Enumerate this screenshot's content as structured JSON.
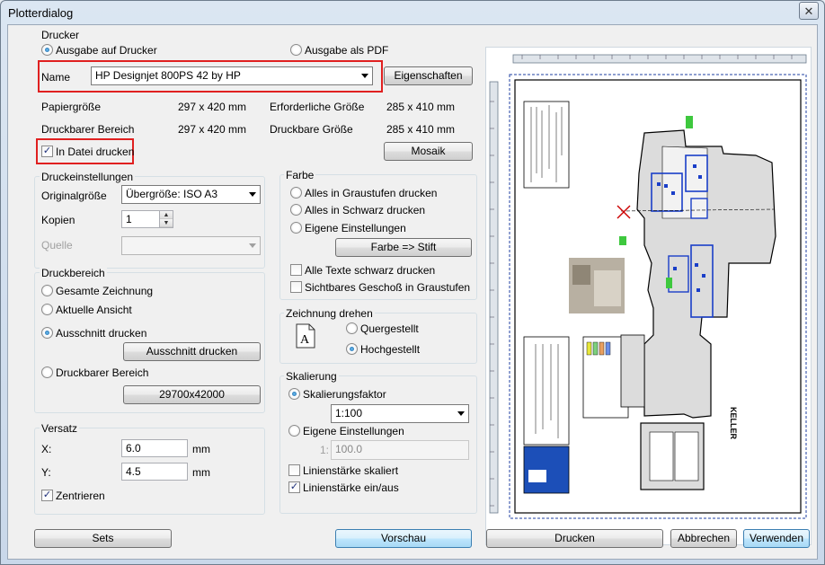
{
  "window": {
    "title": "Plotterdialog",
    "close_glyph": "✕"
  },
  "drucker": {
    "group_label": "Drucker",
    "radio_printer": "Ausgabe auf Drucker",
    "radio_pdf": "Ausgabe als PDF",
    "name_label": "Name",
    "printer_name": "HP Designjet 800PS 42 by HP",
    "properties_button": "Eigenschaften",
    "paper_size_label": "Papiergröße",
    "paper_size_value": "297 x 420 mm",
    "required_size_label": "Erforderliche Größe",
    "required_size_value": "285 x 410 mm",
    "printable_area_label": "Druckbarer Bereich",
    "printable_area_value": "297 x 420 mm",
    "printable_size_label": "Druckbare Größe",
    "printable_size_value": "285 x 410 mm",
    "print_to_file_label": "In Datei drucken",
    "print_to_file_checked": true,
    "mosaic_button": "Mosaik"
  },
  "druckeinstellungen": {
    "group_label": "Druckeinstellungen",
    "original_size_label": "Originalgröße",
    "original_size_value": "Übergröße: ISO A3",
    "copies_label": "Kopien",
    "copies_value": "1",
    "source_label": "Quelle",
    "source_value": ""
  },
  "druckbereich": {
    "group_label": "Druckbereich",
    "radio_full": "Gesamte Zeichnung",
    "radio_current": "Aktuelle Ansicht",
    "radio_section": "Ausschnitt drucken",
    "section_button": "Ausschnitt drucken",
    "radio_printable": "Druckbarer Bereich",
    "printable_button": "29700x42000"
  },
  "versatz": {
    "group_label": "Versatz",
    "x_label": "X:",
    "x_value": "6.0",
    "x_unit": "mm",
    "y_label": "Y:",
    "y_value": "4.5",
    "y_unit": "mm",
    "center_label": "Zentrieren",
    "center_checked": true
  },
  "farbe": {
    "group_label": "Farbe",
    "radio_gray": "Alles in Graustufen drucken",
    "radio_black": "Alles in Schwarz drucken",
    "radio_custom": "Eigene Einstellungen",
    "color_pen_button": "Farbe => Stift",
    "check_text_black": "Alle Texte schwarz drucken",
    "check_visible_floor": "Sichtbares Geschoß in Graustufen"
  },
  "zeichnung_drehen": {
    "group_label": "Zeichnung drehen",
    "radio_landscape": "Quergestellt",
    "radio_portrait": "Hochgestellt",
    "page_icon_glyph": "A"
  },
  "skalierung": {
    "group_label": "Skalierung",
    "radio_factor": "Skalierungsfaktor",
    "factor_value": "1:100",
    "radio_custom": "Eigene Einstellungen",
    "custom_prefix": "1:",
    "custom_value": "100.0",
    "check_linewidth_scaled": "Linienstärke skaliert",
    "check_linewidth_onoff": "Linienstärke ein/aus",
    "linewidth_onoff_checked": true
  },
  "footer": {
    "sets_button": "Sets",
    "preview_button": "Vorschau",
    "print_button": "Drucken",
    "cancel_button": "Abbrechen",
    "apply_button": "Verwenden"
  },
  "preview": {
    "vertical_plan_texts": [
      "KELLER"
    ]
  },
  "colors": {
    "highlight_red": "#e02020",
    "accent_blue": "#1a5fa0"
  }
}
